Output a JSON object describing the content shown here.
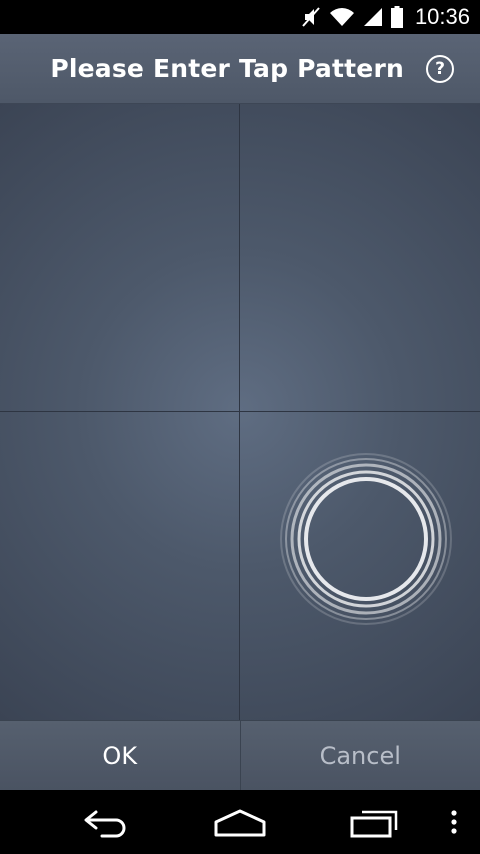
{
  "status_bar": {
    "time": "10:36",
    "icons": [
      "mute-icon",
      "wifi-icon",
      "signal-icon",
      "battery-icon"
    ]
  },
  "header": {
    "title": "Please Enter Tap Pattern",
    "help_glyph": "?"
  },
  "tap_area": {
    "quadrants": [
      "top-left",
      "top-right",
      "bottom-left",
      "bottom-right"
    ],
    "active_quadrant": "bottom-right"
  },
  "buttons": {
    "ok_label": "OK",
    "cancel_label": "Cancel"
  },
  "nav_bar": {
    "icons": [
      "back-icon",
      "home-icon",
      "recent-apps-icon",
      "overflow-menu-icon"
    ]
  },
  "colors": {
    "header_bg": "#535d6c",
    "tap_area_center": "#5f6d82",
    "tap_area_edge": "#3b4454",
    "ok_text": "#ffffff",
    "cancel_text": "#b8bec8"
  }
}
